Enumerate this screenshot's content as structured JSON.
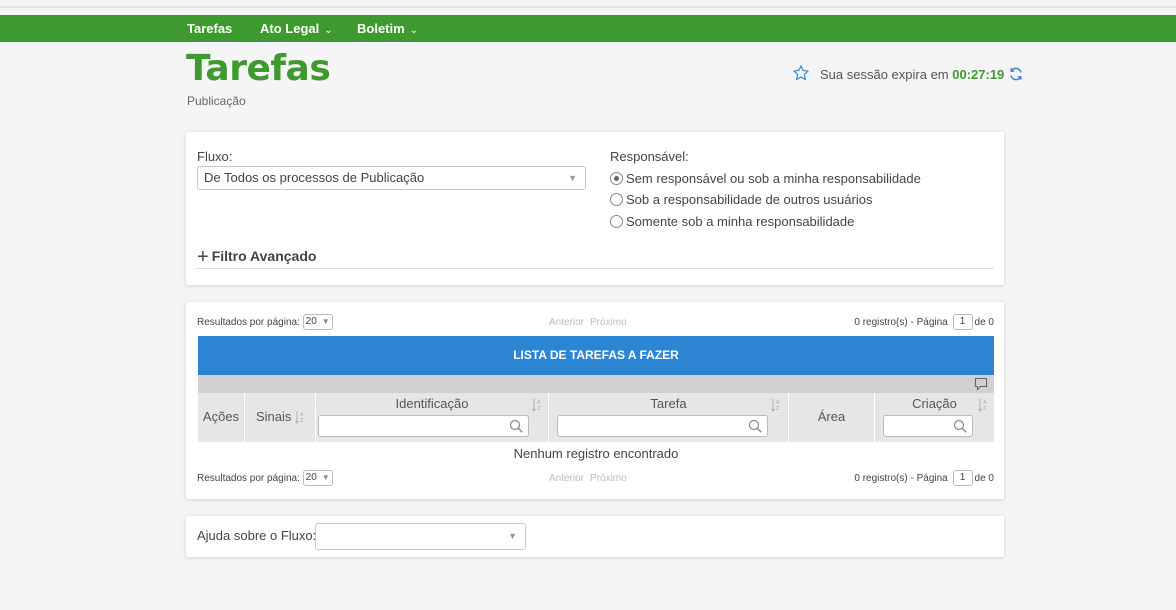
{
  "nav": {
    "items": [
      {
        "label": "Tarefas",
        "has_dropdown": false
      },
      {
        "label": "Ato Legal",
        "has_dropdown": true
      },
      {
        "label": "Boletim",
        "has_dropdown": true
      }
    ]
  },
  "page": {
    "title": "Tarefas",
    "subtitle": "Publicação"
  },
  "session": {
    "text": "Sua sessão expira em",
    "time": "00:27:19"
  },
  "filter": {
    "fluxo_label": "Fluxo:",
    "fluxo_value": "De Todos os processos de Publicação",
    "responsavel_label": "Responsável:",
    "options": [
      {
        "label": "Sem responsável ou sob a minha responsabilidade",
        "selected": true
      },
      {
        "label": "Sob a responsabilidade de outros usuários",
        "selected": false
      },
      {
        "label": "Somente sob a minha responsabilidade",
        "selected": false
      }
    ],
    "advanced_label": "Filtro Avançado"
  },
  "pager": {
    "per_page_label": "Resultados por página:",
    "per_page_value": "20",
    "prev": "Anterior",
    "next": "Próximo",
    "records_text": "0 registro(s) - Página",
    "page": "1",
    "of_text": "de 0"
  },
  "list": {
    "title": "LISTA DE TAREFAS A FAZER",
    "columns": {
      "acoes": "Ações",
      "sinais": "Sinais",
      "identificacao": "Identificação",
      "tarefa": "Tarefa",
      "area": "Área",
      "criacao": "Criação"
    },
    "empty_text": "Nenhum registro encontrado"
  },
  "help": {
    "label": "Ajuda sobre o Fluxo:",
    "value": ""
  },
  "colors": {
    "brand_green": "#3e9a2e",
    "header_blue": "#2b85d3"
  }
}
